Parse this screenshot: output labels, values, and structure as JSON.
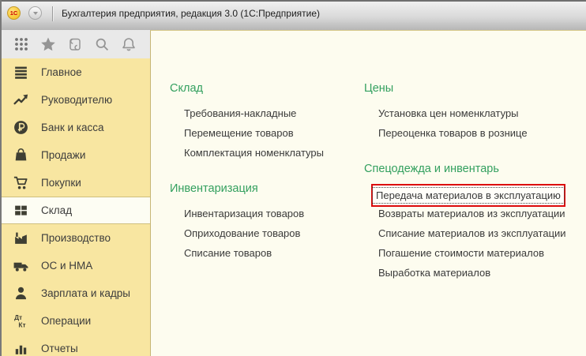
{
  "window": {
    "title": "Бухгалтерия предприятия, редакция 3.0  (1С:Предприятие)",
    "logo_text": "1С"
  },
  "toolbar": {
    "icons": [
      {
        "name": "apps-grid-icon"
      },
      {
        "name": "favorites-star-icon"
      },
      {
        "name": "history-scroll-icon"
      },
      {
        "name": "search-icon"
      },
      {
        "name": "notifications-bell-icon"
      }
    ]
  },
  "sidebar": {
    "items": [
      {
        "key": "glavnoe",
        "label": "Главное",
        "icon": "hamburger-icon",
        "selected": false
      },
      {
        "key": "rukovoditelyu",
        "label": "Руководителю",
        "icon": "trend-icon",
        "selected": false
      },
      {
        "key": "bank-i-kassa",
        "label": "Банк и касса",
        "icon": "ruble-icon",
        "selected": false
      },
      {
        "key": "prodazhi",
        "label": "Продажи",
        "icon": "bag-icon",
        "selected": false
      },
      {
        "key": "pokupki",
        "label": "Покупки",
        "icon": "cart-icon",
        "selected": false
      },
      {
        "key": "sklad",
        "label": "Склад",
        "icon": "boxes-icon",
        "selected": true
      },
      {
        "key": "proizvodstvo",
        "label": "Производство",
        "icon": "factory-icon",
        "selected": false
      },
      {
        "key": "os-i-nma",
        "label": "ОС и НМА",
        "icon": "truck-icon",
        "selected": false
      },
      {
        "key": "zarplata-i-kadry",
        "label": "Зарплата и кадры",
        "icon": "person-icon",
        "selected": false
      },
      {
        "key": "operatsii",
        "label": "Операции",
        "icon": "dtkt-icon",
        "selected": false
      },
      {
        "key": "otchety",
        "label": "Отчеты",
        "icon": "barchart-icon",
        "selected": false
      }
    ]
  },
  "content": {
    "columns": [
      {
        "sections": [
          {
            "key": "sklad",
            "title": "Склад",
            "items": [
              {
                "key": "trebovaniya-nakladnye",
                "label": "Требования-накладные",
                "highlighted": false
              },
              {
                "key": "peremeshchenie-tovarov",
                "label": "Перемещение товаров",
                "highlighted": false
              },
              {
                "key": "komplektatsiya-nomenklatury",
                "label": "Комплектация номенклатуры",
                "highlighted": false
              }
            ]
          },
          {
            "key": "inventarizatsiya",
            "title": "Инвентаризация",
            "items": [
              {
                "key": "inventarizatsiya-tovarov",
                "label": "Инвентаризация товаров",
                "highlighted": false
              },
              {
                "key": "oprikhodovanie-tovarov",
                "label": "Оприходование товаров",
                "highlighted": false
              },
              {
                "key": "spisanie-tovarov",
                "label": "Списание товаров",
                "highlighted": false
              }
            ]
          }
        ]
      },
      {
        "sections": [
          {
            "key": "tseny",
            "title": "Цены",
            "items": [
              {
                "key": "ustanovka-tsen-nomenklatury",
                "label": "Установка цен номенклатуры",
                "highlighted": false
              },
              {
                "key": "pereotsenka-tovarov-v-roznitse",
                "label": "Переоценка товаров в рознице",
                "highlighted": false
              }
            ]
          },
          {
            "key": "spetsodezhda-i-inventar",
            "title": "Спецодежда и инвентарь",
            "items": [
              {
                "key": "peredacha-materialov-v-ekspluatatsiyu",
                "label": "Передача материалов в эксплуатацию",
                "highlighted": true
              },
              {
                "key": "vozvraty-materialov-iz-ekspluatatsii",
                "label": "Возвраты материалов из эксплуатации",
                "highlighted": false
              },
              {
                "key": "spisanie-materialov-iz-ekspluatatsii",
                "label": "Списание материалов из эксплуатации",
                "highlighted": false
              },
              {
                "key": "pogashenie-stoimosti-materialov",
                "label": "Погашение стоимости материалов",
                "highlighted": false
              },
              {
                "key": "vyrabotka-materialov",
                "label": "Выработка материалов",
                "highlighted": false
              }
            ]
          }
        ]
      }
    ]
  },
  "colors": {
    "sidebar_bg": "#f8e6a1",
    "selected_item_bg": "#fdfdf3",
    "content_bg": "#fdfcef",
    "section_title_green": "#33a05f",
    "highlight_red": "#dc0a0a"
  }
}
